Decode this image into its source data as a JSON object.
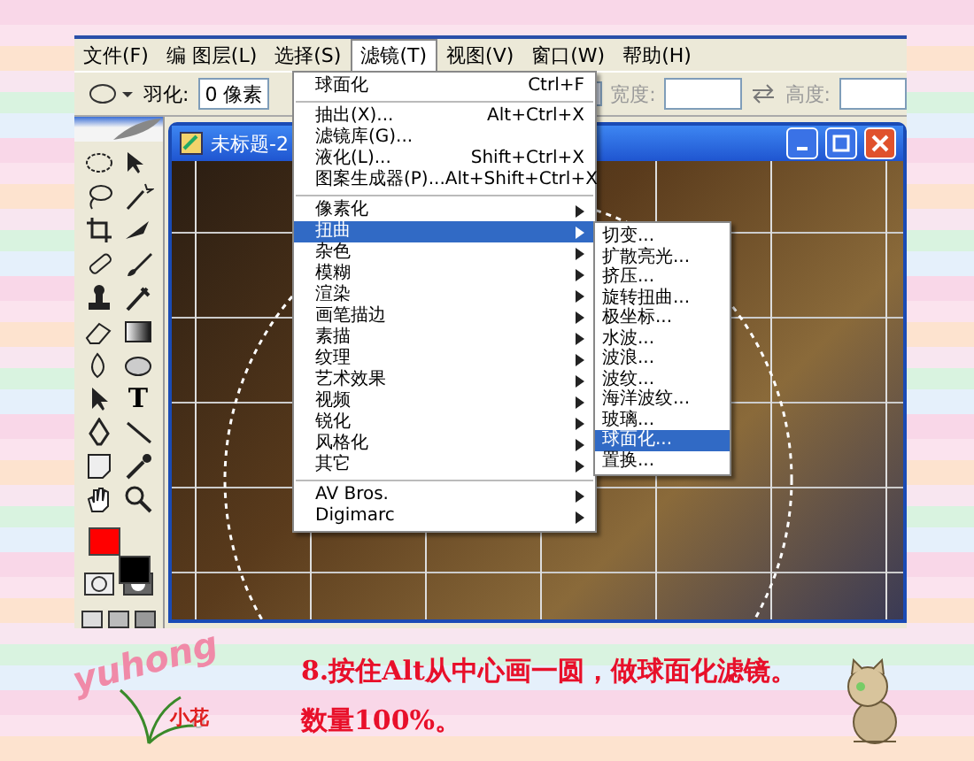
{
  "menu_bar": [
    {
      "label": "文件(F)",
      "selected": false
    },
    {
      "label": "编 图层(L)",
      "selected": false
    },
    {
      "label": "选择(S)",
      "selected": false
    },
    {
      "label": "滤镜(T)",
      "selected": true
    },
    {
      "label": "视图(V)",
      "selected": false
    },
    {
      "label": "窗口(W)",
      "selected": false
    },
    {
      "label": "帮助(H)",
      "selected": false
    }
  ],
  "options_bar": {
    "feather_label": "羽化:",
    "feather_value": "0 像素",
    "width_label": "宽度:",
    "height_label": "高度:"
  },
  "toolbox": {
    "text_tool_glyph": "T",
    "swatches": [
      {
        "color": "#ff0000"
      },
      {
        "color": "#000000"
      }
    ]
  },
  "document": {
    "title": "未标题-2"
  },
  "filter_menu": [
    {
      "kind": "item",
      "label": "球面化",
      "shortcut": "Ctrl+F"
    },
    {
      "kind": "separator"
    },
    {
      "kind": "item",
      "label": "抽出(X)...",
      "shortcut": "Alt+Ctrl+X"
    },
    {
      "kind": "item",
      "label": "滤镜库(G)..."
    },
    {
      "kind": "item",
      "label": "液化(L)...",
      "shortcut": "Shift+Ctrl+X"
    },
    {
      "kind": "item",
      "label": "图案生成器(P)...",
      "shortcut": "Alt+Shift+Ctrl+X"
    },
    {
      "kind": "separator"
    },
    {
      "kind": "submenu",
      "label": "像素化",
      "selected": false
    },
    {
      "kind": "submenu",
      "label": "扭曲",
      "selected": true
    },
    {
      "kind": "submenu",
      "label": "杂色",
      "selected": false
    },
    {
      "kind": "submenu",
      "label": "模糊",
      "selected": false
    },
    {
      "kind": "submenu",
      "label": "渲染",
      "selected": false
    },
    {
      "kind": "submenu",
      "label": "画笔描边",
      "selected": false
    },
    {
      "kind": "submenu",
      "label": "素描",
      "selected": false
    },
    {
      "kind": "submenu",
      "label": "纹理",
      "selected": false
    },
    {
      "kind": "submenu",
      "label": "艺术效果",
      "selected": false
    },
    {
      "kind": "submenu",
      "label": "视频",
      "selected": false
    },
    {
      "kind": "submenu",
      "label": "锐化",
      "selected": false
    },
    {
      "kind": "submenu",
      "label": "风格化",
      "selected": false
    },
    {
      "kind": "submenu",
      "label": "其它",
      "selected": false
    },
    {
      "kind": "separator"
    },
    {
      "kind": "submenu",
      "label": "AV Bros.",
      "selected": false
    },
    {
      "kind": "submenu",
      "label": "Digimarc",
      "selected": false
    }
  ],
  "distort_submenu": [
    {
      "label": "切变...",
      "selected": false
    },
    {
      "label": "扩散亮光...",
      "selected": false
    },
    {
      "label": "挤压...",
      "selected": false
    },
    {
      "label": "旋转扭曲...",
      "selected": false
    },
    {
      "label": "极坐标...",
      "selected": false
    },
    {
      "label": "水波...",
      "selected": false
    },
    {
      "label": "波浪...",
      "selected": false
    },
    {
      "label": "波纹...",
      "selected": false
    },
    {
      "label": "海洋波纹...",
      "selected": false
    },
    {
      "label": "玻璃...",
      "selected": false
    },
    {
      "label": "球面化...",
      "selected": true
    },
    {
      "label": "置换...",
      "selected": false
    }
  ],
  "logo": {
    "name": "yuhong",
    "sub": "小花"
  },
  "caption": [
    "8.按住Alt从中心画一圆，做球面化滤镜。",
    "数量100%。"
  ]
}
